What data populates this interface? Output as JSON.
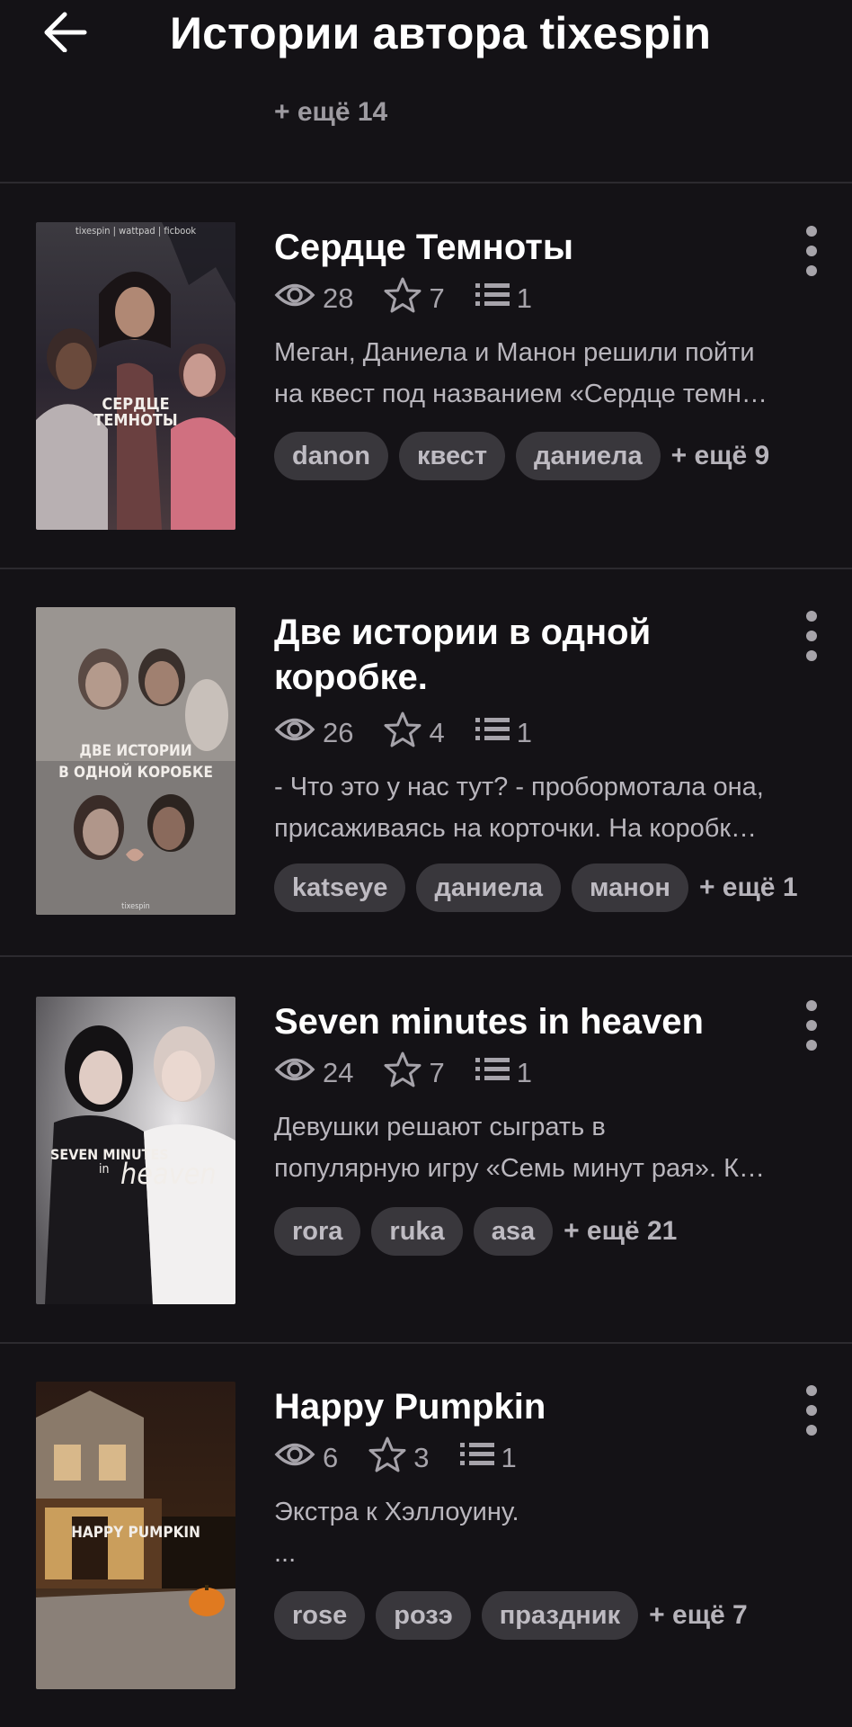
{
  "header": {
    "title": "Истории автора tixespin",
    "more_label": "+ ещё 14"
  },
  "colors": {
    "background": "#141216",
    "tag_bg": "#39373c",
    "muted_text": "#a6a3aa"
  },
  "stories": [
    {
      "title": "Сердце Темноты",
      "views": "28",
      "stars": "7",
      "chapters": "1",
      "description": [
        "Меган, Даниела и Манон решили пойти",
        "на квест под названием «Сердце темн…"
      ],
      "tags": [
        "danon",
        "квест",
        "даниела"
      ],
      "more_tags": "+ ещё 9",
      "cover": {
        "top_text": "tixespin | wattpad | ficbook",
        "lines": [
          "СЕРДЦЕ",
          "ТЕМНОТЫ"
        ]
      }
    },
    {
      "title": "Две истории в одной коробке.",
      "views": "26",
      "stars": "4",
      "chapters": "1",
      "description": [
        "- Что это у нас тут? - пробормотала она,",
        "присаживаясь на корточки. На коробк…"
      ],
      "tags": [
        "katseye",
        "даниела",
        "манон"
      ],
      "more_tags": "+ ещё 1",
      "cover": {
        "lines": [
          "ДВЕ ИСТОРИИ",
          "В ОДНОЙ КОРОБКЕ"
        ],
        "bottom_text": "tixespin"
      }
    },
    {
      "title": "Seven minutes in heaven",
      "views": "24",
      "stars": "7",
      "chapters": "1",
      "description": [
        "Девушки решают сыграть в",
        "популярную игру «Семь минут рая». К…"
      ],
      "tags": [
        "rora",
        "ruka",
        "asa"
      ],
      "more_tags": "+ ещё 21",
      "cover": {
        "lines": [
          "SEVEN MINUTES",
          "in",
          "heaven"
        ]
      }
    },
    {
      "title": "Happy Pumpkin",
      "views": "6",
      "stars": "3",
      "chapters": "1",
      "description": [
        "Экстра к Хэллоуину.",
        "..."
      ],
      "tags": [
        "rose",
        "розэ",
        "праздник"
      ],
      "more_tags": "+ ещё 7",
      "cover": {
        "lines": [
          "HAPPY PUMPKIN"
        ]
      }
    }
  ]
}
